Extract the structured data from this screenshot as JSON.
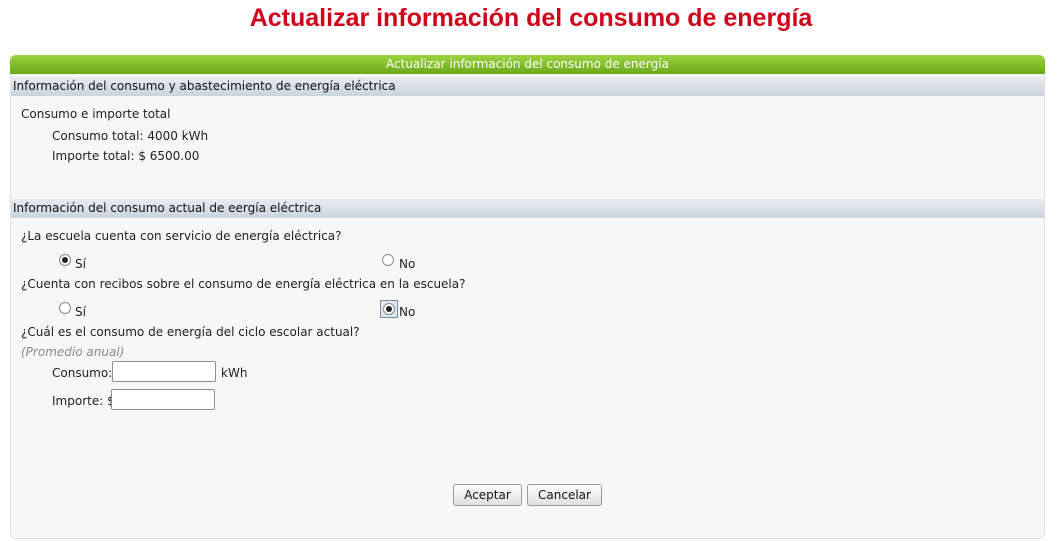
{
  "page": {
    "title": "Actualizar información del consumo de energía"
  },
  "panel": {
    "header": "Actualizar información del consumo de energía"
  },
  "section1": {
    "title": "Información del consumo y abastecimiento de energía eléctrica",
    "subtitle": "Consumo e importe total",
    "consumo_total": "Consumo total: 4000  kWh",
    "importe_total": "Importe total: $ 6500.00"
  },
  "section2": {
    "title": "Información del consumo actual de eergía eléctrica",
    "q1": {
      "label": "¿La escuela cuenta con servicio de energía eléctrica?",
      "option_yes": "Sí",
      "option_no": "No",
      "selected": "Sí"
    },
    "q2": {
      "label": "¿Cuenta con recibos sobre el consumo de energía eléctrica en la escuela?",
      "option_yes": "Sí",
      "option_no": "No",
      "selected": "No"
    },
    "q3": {
      "label": "¿Cuál es el consumo de energía del ciclo escolar actual?",
      "hint": "(Promedio anual)",
      "consumo_label": "Consumo:",
      "consumo_value": "",
      "consumo_unit": "kWh",
      "importe_label": "Importe: $",
      "importe_value": ""
    }
  },
  "actions": {
    "accept": "Aceptar",
    "cancel": "Cancelar"
  }
}
